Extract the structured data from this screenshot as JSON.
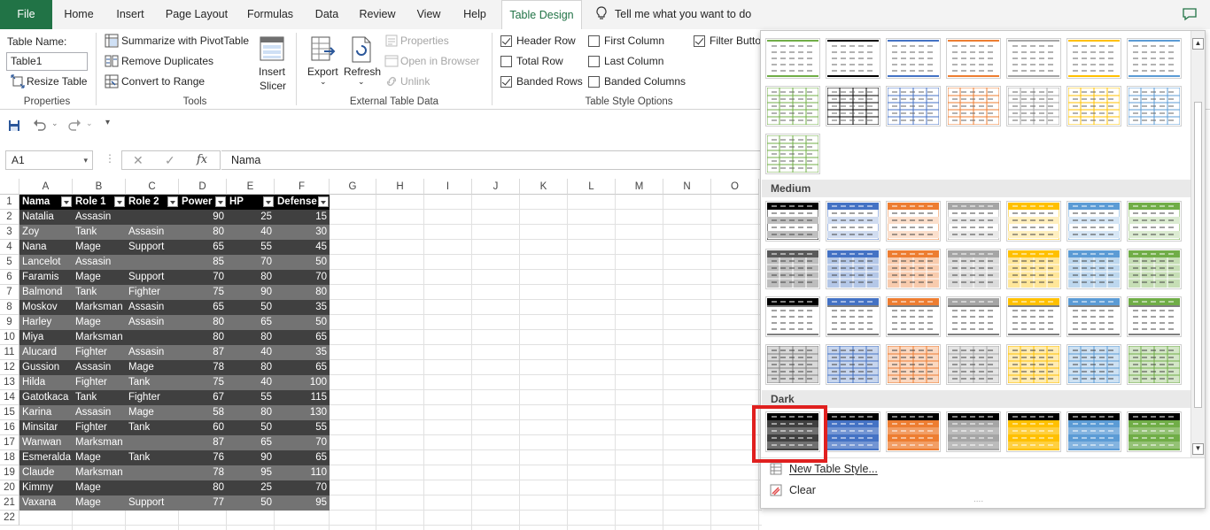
{
  "tabs": [
    "File",
    "Home",
    "Insert",
    "Page Layout",
    "Formulas",
    "Data",
    "Review",
    "View",
    "Help",
    "Table Design"
  ],
  "tell_me": "Tell me what you want to do",
  "ribbon": {
    "properties": {
      "table_name_label": "Table Name:",
      "table_name_value": "Table1",
      "resize": "Resize Table",
      "group": "Properties"
    },
    "tools": {
      "summarize": "Summarize with PivotTable",
      "remove_dup": "Remove Duplicates",
      "convert": "Convert to Range",
      "insert_slicer_1": "Insert",
      "insert_slicer_2": "Slicer",
      "group": "Tools"
    },
    "external": {
      "export": "Export",
      "refresh": "Refresh",
      "properties": "Properties",
      "open_browser": "Open in Browser",
      "unlink": "Unlink",
      "group": "External Table Data"
    },
    "style_options": {
      "header_row": "Header Row",
      "total_row": "Total Row",
      "banded_rows": "Banded Rows",
      "first_column": "First Column",
      "last_column": "Last Column",
      "banded_columns": "Banded Columns",
      "filter_button": "Filter Butto",
      "group": "Table Style Options",
      "checked": {
        "header_row": true,
        "total_row": false,
        "banded_rows": true,
        "first_column": false,
        "last_column": false,
        "banded_columns": false,
        "filter_button": true
      }
    }
  },
  "formula_bar": {
    "name_box": "A1",
    "fx": "fx",
    "formula": "Nama"
  },
  "columns": [
    "A",
    "B",
    "C",
    "D",
    "E",
    "F",
    "G",
    "H",
    "I",
    "J",
    "K",
    "L",
    "M",
    "N",
    "O"
  ],
  "rows": [
    "1",
    "2",
    "3",
    "4",
    "5",
    "6",
    "7",
    "8",
    "9",
    "10",
    "11",
    "12",
    "13",
    "14",
    "15",
    "16",
    "17",
    "18",
    "19",
    "20",
    "21",
    "22"
  ],
  "table": {
    "headers": [
      "Nama",
      "Role 1",
      "Role 2",
      "Power",
      "HP",
      "Defense"
    ],
    "data": [
      [
        "Natalia",
        "Assasin",
        "",
        "90",
        "25",
        "15"
      ],
      [
        "Zoy",
        "Tank",
        "Assasin",
        "80",
        "40",
        "30"
      ],
      [
        "Nana",
        "Mage",
        "Support",
        "65",
        "55",
        "45"
      ],
      [
        "Lancelot",
        "Assasin",
        "",
        "85",
        "70",
        "50"
      ],
      [
        "Faramis",
        "Mage",
        "Support",
        "70",
        "80",
        "70"
      ],
      [
        "Balmond",
        "Tank",
        "Fighter",
        "75",
        "90",
        "80"
      ],
      [
        "Moskov",
        "Marksman",
        "Assasin",
        "65",
        "50",
        "35"
      ],
      [
        "Harley",
        "Mage",
        "Assasin",
        "80",
        "65",
        "50"
      ],
      [
        "Miya",
        "Marksman",
        "",
        "80",
        "80",
        "65"
      ],
      [
        "Alucard",
        "Fighter",
        "Assasin",
        "87",
        "40",
        "35"
      ],
      [
        "Gussion",
        "Assasin",
        "Mage",
        "78",
        "80",
        "65"
      ],
      [
        "Hilda",
        "Fighter",
        "Tank",
        "75",
        "40",
        "100"
      ],
      [
        "Gatotkaca",
        "Tank",
        "Fighter",
        "67",
        "55",
        "115"
      ],
      [
        "Karina",
        "Assasin",
        "Mage",
        "58",
        "80",
        "130"
      ],
      [
        "Minsitar",
        "Fighter",
        "Tank",
        "60",
        "50",
        "55"
      ],
      [
        "Wanwan",
        "Marksman",
        "",
        "87",
        "65",
        "70"
      ],
      [
        "Esmeralda",
        "Mage",
        "Tank",
        "76",
        "90",
        "65"
      ],
      [
        "Claude",
        "Marksman",
        "",
        "78",
        "95",
        "110"
      ],
      [
        "Kimmy",
        "Mage",
        "",
        "80",
        "25",
        "70"
      ],
      [
        "Vaxana",
        "Mage",
        "Support",
        "77",
        "50",
        "95"
      ]
    ],
    "colors": {
      "header": "#000000",
      "band_dark": "#404040",
      "band_light": "#737373"
    }
  },
  "gallery": {
    "sections": {
      "medium": "Medium",
      "dark": "Dark"
    },
    "new_style": "New Table Style...",
    "clear": "Clear",
    "palette": [
      "#262626",
      "#4472c4",
      "#ed7d31",
      "#a5a5a5",
      "#ffc000",
      "#5b9bd5",
      "#70ad47"
    ],
    "light_colors": [
      "#000000",
      "#4472c4",
      "#ed7d31",
      "#a5a5a5",
      "#ffc000",
      "#5b9bd5"
    ],
    "highlight_color": "#e0201f"
  }
}
